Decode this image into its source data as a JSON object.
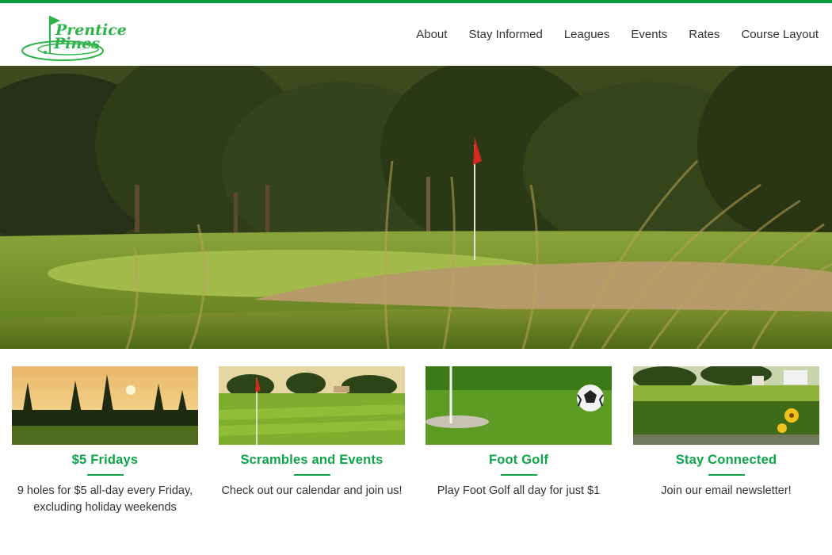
{
  "site": {
    "logo_line1": "Prentice",
    "logo_line2": "Pines",
    "brand_color": "#0a9a3e"
  },
  "nav": {
    "items": [
      {
        "label": "About"
      },
      {
        "label": "Stay Informed"
      },
      {
        "label": "Leagues"
      },
      {
        "label": "Events"
      },
      {
        "label": "Rates"
      },
      {
        "label": "Course Layout"
      }
    ]
  },
  "hero": {
    "slide_count": 3,
    "active_slide": 1
  },
  "cards": [
    {
      "title": "$5 Fridays",
      "text": "9 holes for $5 all-day every Friday, excluding holiday weekends",
      "icon": "sunset-trees-photo"
    },
    {
      "title": "Scrambles and Events",
      "text": "Check out our calendar and join us!",
      "icon": "fairway-flag-photo"
    },
    {
      "title": "Foot Golf",
      "text": "Play Foot Golf all day for just $1",
      "icon": "soccer-ball-photo"
    },
    {
      "title": "Stay Connected",
      "text": "Join our email newsletter!",
      "icon": "pond-sunflower-photo"
    }
  ]
}
